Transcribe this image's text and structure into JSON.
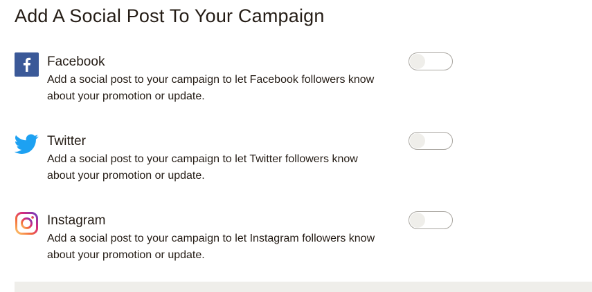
{
  "title": "Add A Social Post To Your Campaign",
  "networks": [
    {
      "name": "Facebook",
      "description_line1": "Add a social post to your campaign to let Facebook followers know",
      "description_line2": "about your promotion or update.",
      "icon": "facebook-icon",
      "enabled": false,
      "color": "#3b5998"
    },
    {
      "name": "Twitter",
      "description_line1": "Add a social post to your campaign to let Twitter followers know",
      "description_line2": "about your promotion or update.",
      "icon": "twitter-icon",
      "enabled": false,
      "color": "#1da1f2"
    },
    {
      "name": "Instagram",
      "description_line1": "Add a social post to your campaign to let Instagram followers know",
      "description_line2": "about your promotion or update.",
      "icon": "instagram-icon",
      "enabled": false,
      "color": "#c13584"
    }
  ]
}
